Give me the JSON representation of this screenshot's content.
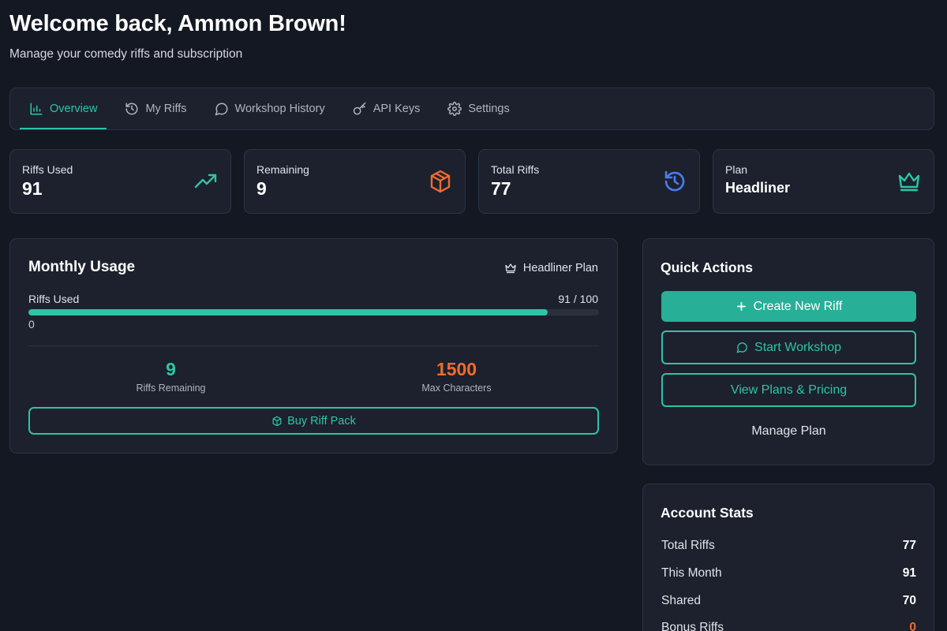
{
  "header": {
    "title": "Welcome back, Ammon Brown!",
    "subtitle": "Manage your comedy riffs and subscription"
  },
  "tabs": [
    {
      "label": "Overview",
      "icon": "bar-chart-icon",
      "active": true
    },
    {
      "label": "My Riffs",
      "icon": "history-icon",
      "active": false
    },
    {
      "label": "Workshop History",
      "icon": "chat-bubble-icon",
      "active": false
    },
    {
      "label": "API Keys",
      "icon": "key-icon",
      "active": false
    },
    {
      "label": "Settings",
      "icon": "gear-icon",
      "active": false
    }
  ],
  "stats": [
    {
      "label": "Riffs Used",
      "value": "91",
      "icon": "trending-up-icon",
      "color": "#2ec4a6"
    },
    {
      "label": "Remaining",
      "value": "9",
      "icon": "package-icon",
      "color": "#f26b2e"
    },
    {
      "label": "Total Riffs",
      "value": "77",
      "icon": "history-icon",
      "color": "#4a7cf0"
    },
    {
      "label": "Plan",
      "value": "Headliner",
      "icon": "crown-icon",
      "color": "#2ec4a6"
    }
  ],
  "usage": {
    "title": "Monthly Usage",
    "plan_label": "Headliner Plan",
    "bar_label": "Riffs Used",
    "bar_count": "91 / 100",
    "bar_min": "0",
    "progress_fraction": 0.91,
    "remaining_value": "9",
    "remaining_caption": "Riffs Remaining",
    "max_chars_value": "1500",
    "max_chars_caption": "Max Characters",
    "buy_label": "Buy Riff Pack"
  },
  "quick_actions": {
    "title": "Quick Actions",
    "create_label": "Create New Riff",
    "workshop_label": "Start Workshop",
    "plans_label": "View Plans & Pricing",
    "manage_label": "Manage Plan"
  },
  "account_stats": {
    "title": "Account Stats",
    "rows": [
      {
        "label": "Total Riffs",
        "value": "77"
      },
      {
        "label": "This Month",
        "value": "91"
      },
      {
        "label": "Shared",
        "value": "70"
      },
      {
        "label": "Bonus Riffs",
        "value": "0"
      }
    ]
  },
  "colors": {
    "background": "#141823",
    "card": "#1c212d",
    "accent": "#2ec4a6",
    "orange": "#f26b2e",
    "blue": "#4a7cf0"
  }
}
